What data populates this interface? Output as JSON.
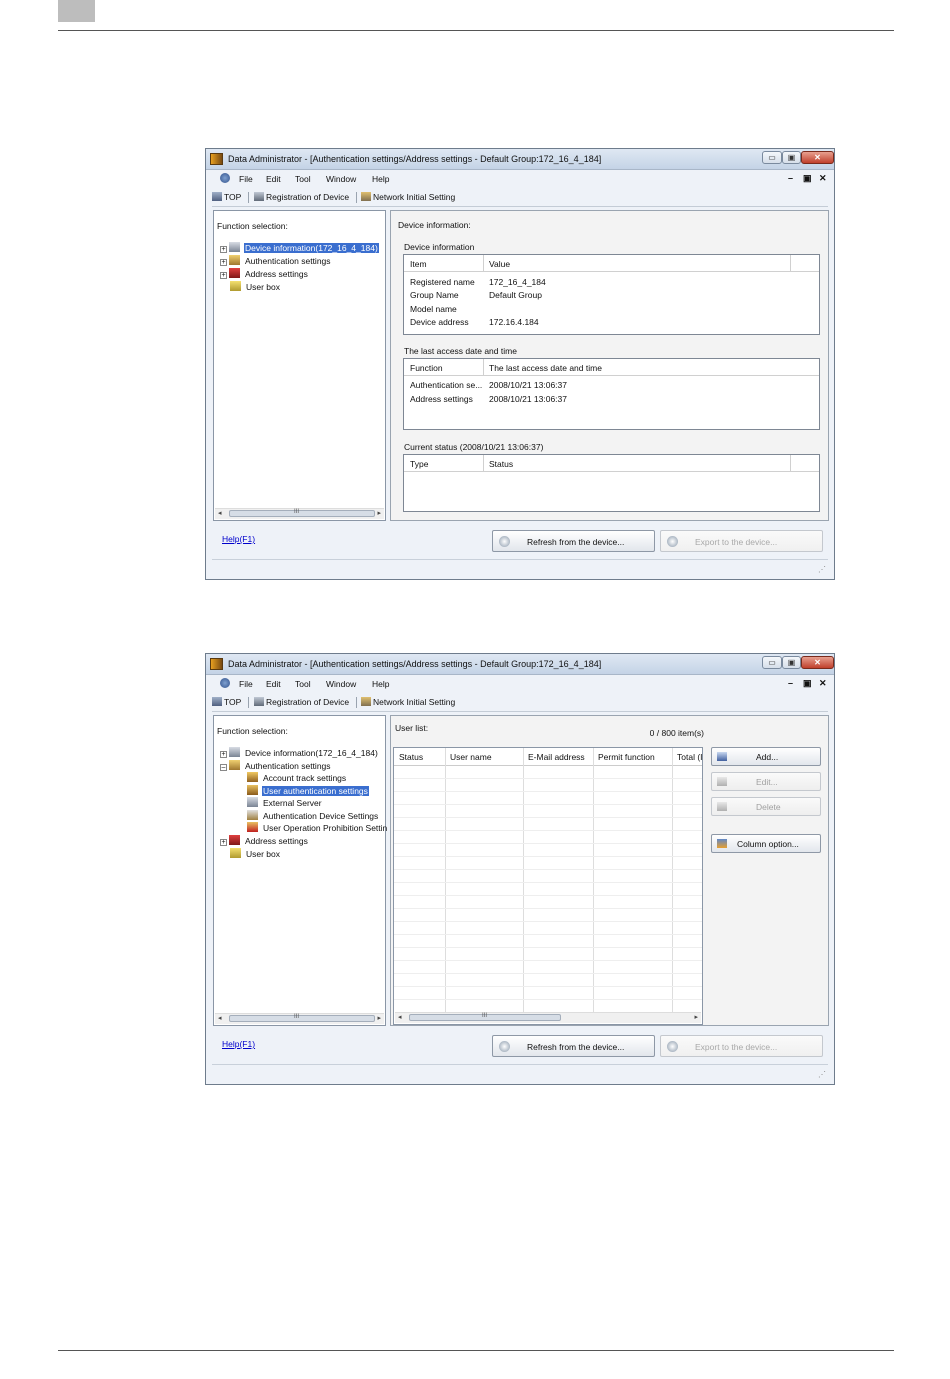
{
  "page": {
    "tab_color": "#bdbdbd"
  },
  "window1": {
    "title": "Data Administrator - [Authentication settings/Address settings - Default Group:172_16_4_184]",
    "controls": {
      "minimize": "▭",
      "maximize": "▣",
      "close": "✕"
    },
    "menu": [
      "File",
      "Edit",
      "Tool",
      "Window",
      "Help"
    ],
    "mdi_controls": {
      "minimize": "–",
      "restore": "▣",
      "close": "✕"
    },
    "toolbar": {
      "top": "TOP",
      "registration": "Registration of Device",
      "network": "Network Initial Setting"
    },
    "function_selection_label": "Function selection:",
    "tree": [
      {
        "label": "Device information(172_16_4_184)",
        "expander": "+",
        "icon": "device-icon"
      },
      {
        "label": "Authentication settings",
        "expander": "+",
        "icon": "auth-icon"
      },
      {
        "label": "Address settings",
        "expander": "+",
        "icon": "address-icon"
      },
      {
        "label": "User box",
        "expander": "",
        "icon": "box-icon"
      }
    ],
    "scroll_mark": "III",
    "device_info_title": "Device information:",
    "device_info_group": "Device information",
    "device_info_columns": [
      "Item",
      "Value"
    ],
    "device_info_rows": [
      {
        "item": "Registered name",
        "value": "172_16_4_184"
      },
      {
        "item": "Group Name",
        "value": "Default Group"
      },
      {
        "item": "Model name",
        "value": ""
      },
      {
        "item": "Device address",
        "value": "172.16.4.184"
      }
    ],
    "last_access_group": "The last access date and time",
    "last_access_columns": [
      "Function",
      "The last access date and time"
    ],
    "last_access_rows": [
      {
        "function": "Authentication se...",
        "time": "2008/10/21 13:06:37"
      },
      {
        "function": "Address settings",
        "time": "2008/10/21 13:06:37"
      }
    ],
    "current_status_group": "Current status (2008/10/21 13:06:37)",
    "current_status_columns": [
      "Type",
      "Status"
    ],
    "help_link": "Help(F1)",
    "refresh_button": "Refresh from the device...",
    "export_button": "Export to the device..."
  },
  "window2": {
    "title": "Data Administrator - [Authentication settings/Address settings - Default Group:172_16_4_184]",
    "function_selection_label": "Function selection:",
    "tree": [
      {
        "label": "Device information(172_16_4_184)",
        "expander": "+",
        "indent": 0
      },
      {
        "label": "Authentication settings",
        "expander": "–",
        "indent": 0
      },
      {
        "label": "Account track settings",
        "expander": "",
        "indent": 1
      },
      {
        "label": "User authentication settings",
        "expander": "",
        "indent": 1,
        "selected": true
      },
      {
        "label": "External Server",
        "expander": "",
        "indent": 1
      },
      {
        "label": "Authentication Device Settings",
        "expander": "",
        "indent": 1
      },
      {
        "label": "User Operation Prohibition Settin",
        "expander": "",
        "indent": 1
      },
      {
        "label": "Address settings",
        "expander": "+",
        "indent": 0
      },
      {
        "label": "User box",
        "expander": "",
        "indent": 0
      }
    ],
    "user_list_label": "User list:",
    "item_count": "0 / 800 item(s)",
    "columns": [
      "Status",
      "User name",
      "E-Mail address",
      "Permit function",
      "Total (I"
    ],
    "buttons": {
      "add": "Add...",
      "edit": "Edit...",
      "delete": "Delete",
      "column_option": "Column option..."
    },
    "help_link": "Help(F1)",
    "refresh_button": "Refresh from the device...",
    "export_button": "Export to the device..."
  },
  "colors": {
    "selection": "#3a6ecf",
    "link": "#0000cc",
    "disabled_text": "#a0a0a0"
  }
}
